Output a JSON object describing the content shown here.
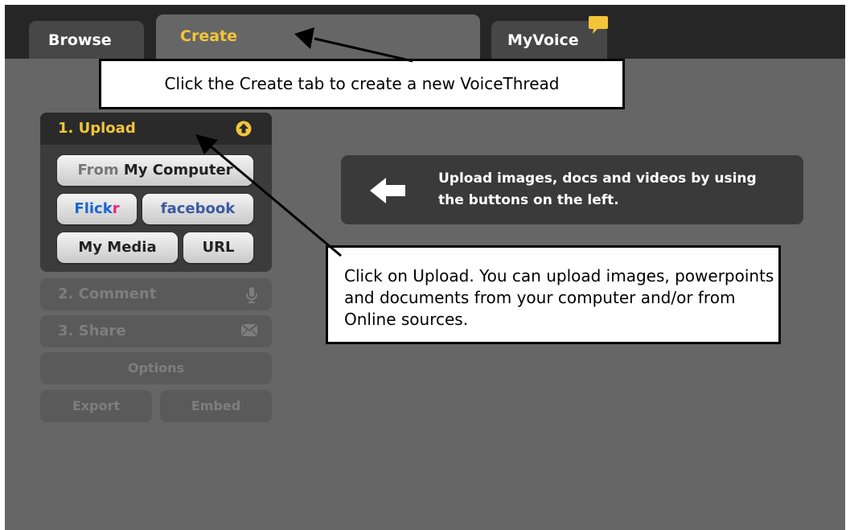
{
  "tabs": {
    "browse": "Browse",
    "create": "Create",
    "myvoice": "MyVoice"
  },
  "sidebar": {
    "upload_title": "1. Upload",
    "buttons": {
      "from": "From",
      "my_computer": "My Computer",
      "flickr_a": "Flick",
      "flickr_b": "r",
      "facebook": "facebook",
      "my_media": "My Media",
      "url": "URL"
    },
    "comment": "2. Comment",
    "share": "3. Share",
    "options": "Options",
    "export": "Export",
    "embed": "Embed"
  },
  "main": {
    "hint_text": "Upload images, docs and videos by using the buttons on the left."
  },
  "annotations": {
    "create_callout": "Click the Create tab to create a new VoiceThread",
    "upload_callout": "Click on Upload. You can upload images, powerpoints and documents from your computer and/or from Online sources."
  },
  "icons": {
    "myvoice": "speech-bubble-icon",
    "upload": "upload-arrow-icon",
    "comment": "microphone-icon",
    "share": "envelope-icon",
    "hint": "left-arrow-icon"
  },
  "colors": {
    "accent": "#f2c53a",
    "background": "#666666",
    "tabbar": "#262626",
    "flickr_blue": "#1a66d1",
    "flickr_pink": "#e8237e",
    "facebook_blue": "#3b5aa0"
  }
}
